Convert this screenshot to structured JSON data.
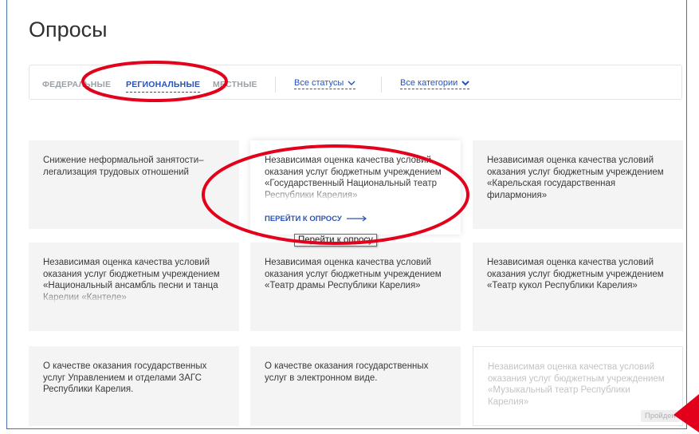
{
  "page": {
    "title": "Опросы"
  },
  "tabs": [
    {
      "label": "ФЕДЕРАЛЬНЫЕ",
      "active": false
    },
    {
      "label": "РЕГИОНАЛЬНЫЕ",
      "active": true
    },
    {
      "label": "МЕСТНЫЕ",
      "active": false
    }
  ],
  "filters": {
    "status": "Все статусы",
    "category": "Все категории"
  },
  "cards": [
    {
      "text": "Снижение неформальной занятости– легализация трудовых отношений"
    },
    {
      "text": "Независимая оценка качества условий оказания услуг бюджетным учреждением «Государственный Национальный театр Республики Карелия»",
      "link": "ПЕРЕЙТИ К ОПРОСУ"
    },
    {
      "text": "Независимая оценка качества условий оказания услуг бюджетным учреждением «Карельская государственная филармония»"
    },
    {
      "text": "Независимая оценка качества условий оказания услуг бюджетным учреждением «Национальный ансамбль песни и танца Карелии «Кантеле»"
    },
    {
      "text": "Независимая оценка качества условий оказания услуг бюджетным учреждением «Театр драмы Республики Карелия»"
    },
    {
      "text": "Независимая оценка качества условий оказания услуг бюджетным учреждением «Театр кукол Республики Карелия»"
    },
    {
      "text": "О качестве оказания государственных услуг Управлением и отделами ЗАГС Республики Карелия."
    },
    {
      "text": "О качестве оказания государственных услуг в электронном виде."
    },
    {
      "text": "Независимая оценка качества условий оказания услуг бюджетным учреждением «Музыкальный театр Республики Карелия»",
      "badge": "Пройден"
    }
  ],
  "tooltip": "Перейти к опросу",
  "colors": {
    "accent": "#2753b8",
    "annotation": "#e3001b",
    "frame": "#4a6fb5"
  }
}
